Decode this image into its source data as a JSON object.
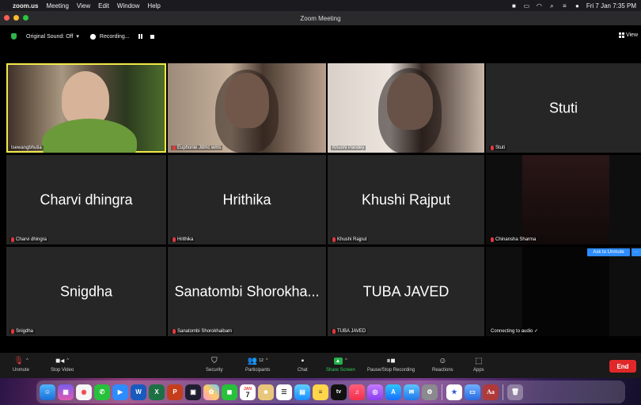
{
  "menubar": {
    "app": "zoom.us",
    "items": [
      "Meeting",
      "View",
      "Edit",
      "Window",
      "Help"
    ],
    "clock": "Fri 7 Jan  7:35 PM"
  },
  "window": {
    "title": "Zoom Meeting"
  },
  "toolbar": {
    "original_sound": "Original Sound: Off",
    "recording": "Recording...",
    "view": "View"
  },
  "tiles": [
    {
      "name": "tsewangbhutia",
      "center": "",
      "muted": false
    },
    {
      "name": "Euphonie Jdmc wms",
      "center": "",
      "muted": true
    },
    {
      "name": "Khushi Pandey",
      "center": "",
      "muted": false
    },
    {
      "name": "Stuti",
      "center": "Stuti",
      "muted": true
    },
    {
      "name": "Charvi dhingra",
      "center": "Charvi dhingra",
      "muted": true
    },
    {
      "name": "Hrithika",
      "center": "Hrithika",
      "muted": true
    },
    {
      "name": "Khushi Rajput",
      "center": "Khushi Rajput",
      "muted": true
    },
    {
      "name": "Chinansha Sharma",
      "center": "",
      "muted": true
    },
    {
      "name": "Snigdha",
      "center": "Snigdha",
      "muted": true
    },
    {
      "name": "Sanatombi Shorokhaibam",
      "center": "Sanatombi Shorokha...",
      "muted": true
    },
    {
      "name": "TUBA JAVED",
      "center": "TUBA JAVED",
      "muted": true
    },
    {
      "name": "Connecting to audio ✓",
      "center": "",
      "muted": false
    }
  ],
  "ask_to_unmute": "Ask to Unmute",
  "more_dots": "···",
  "controls": {
    "unmute": "Unmute",
    "stop_video": "Stop Video",
    "security": "Security",
    "participants": "Participants",
    "participants_count": "12",
    "chat": "Chat",
    "share_screen": "Share Screen",
    "pause_stop_recording": "Pause/Stop Recording",
    "reactions": "Reactions",
    "apps": "Apps",
    "end": "End"
  },
  "dock": {
    "calendar_month": "JAN",
    "calendar_day": "7",
    "tv_label": "tv",
    "dictionary_label": "Aa"
  }
}
